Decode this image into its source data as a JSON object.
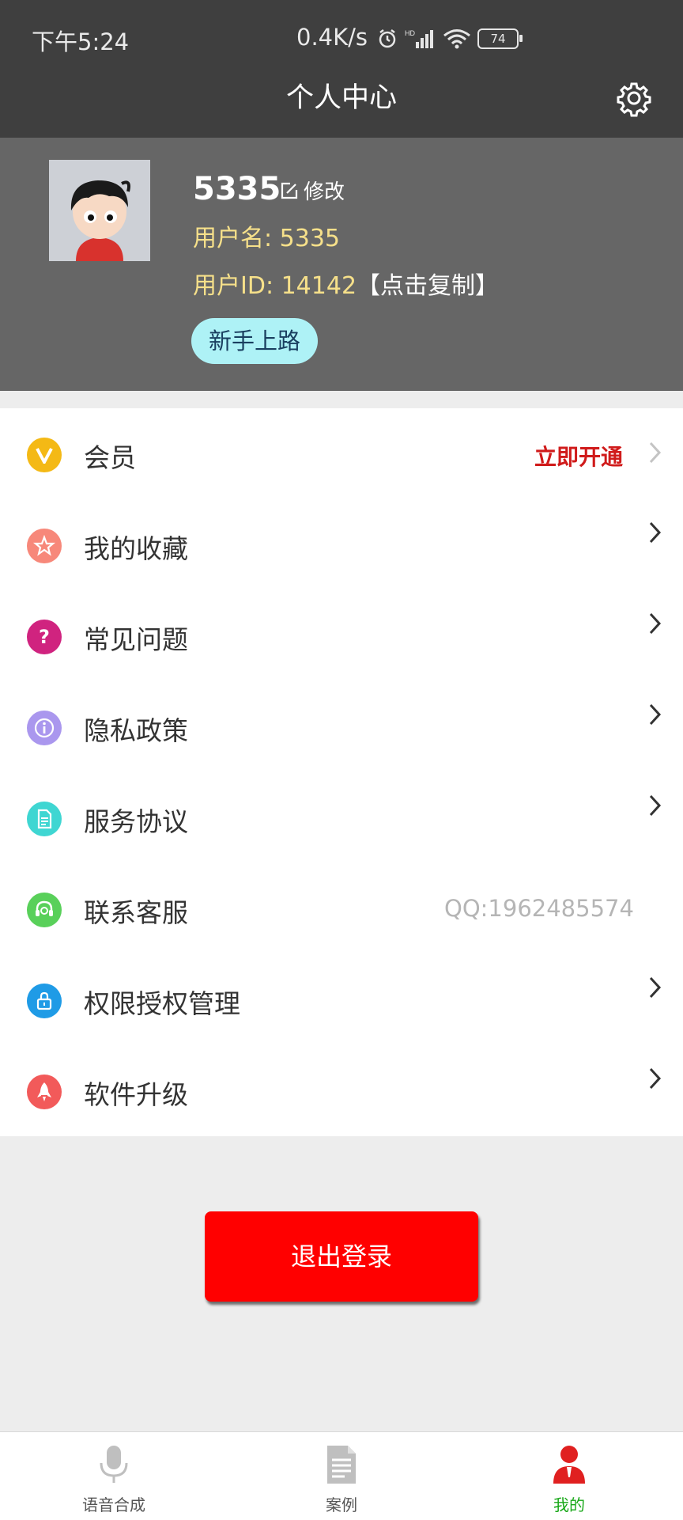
{
  "status_bar": {
    "time": "下午5:24",
    "net_speed": "0.4K/s",
    "battery": "74"
  },
  "header": {
    "title": "个人中心"
  },
  "profile": {
    "nickname": "5335",
    "edit_label": "修改",
    "username": "用户名: 5335",
    "user_id": "用户ID: 14142",
    "copy_label": "【点击复制】",
    "badge": "新手上路"
  },
  "menu": [
    {
      "label": "会员",
      "icon": "vip-icon",
      "color": "#f4b915",
      "right_text": "立即开通"
    },
    {
      "label": "我的收藏",
      "icon": "star-icon",
      "color": "#f7887a"
    },
    {
      "label": "常见问题",
      "icon": "question-icon",
      "color": "#d0237f"
    },
    {
      "label": "隐私政策",
      "icon": "info-icon",
      "color": "#aa97ee"
    },
    {
      "label": "服务协议",
      "icon": "document-icon",
      "color": "#3fd6d2"
    },
    {
      "label": "联系客服",
      "icon": "headset-icon",
      "color": "#59d05a",
      "right_text": "QQ:1962485574"
    },
    {
      "label": "权限授权管理",
      "icon": "lock-icon",
      "color": "#1f9be6"
    },
    {
      "label": "软件升级",
      "icon": "rocket-icon",
      "color": "#f25a5a"
    }
  ],
  "logout_label": "退出登录",
  "tabs": [
    {
      "label": "语音合成",
      "icon": "microphone-icon"
    },
    {
      "label": "案例",
      "icon": "document-icon"
    },
    {
      "label": "我的",
      "icon": "user-icon",
      "active": true
    }
  ],
  "colors": {
    "accent": "#ff0000",
    "active_tab": "#17a717",
    "header_bg": "#3f3f3f",
    "profile_bg": "#666666"
  }
}
